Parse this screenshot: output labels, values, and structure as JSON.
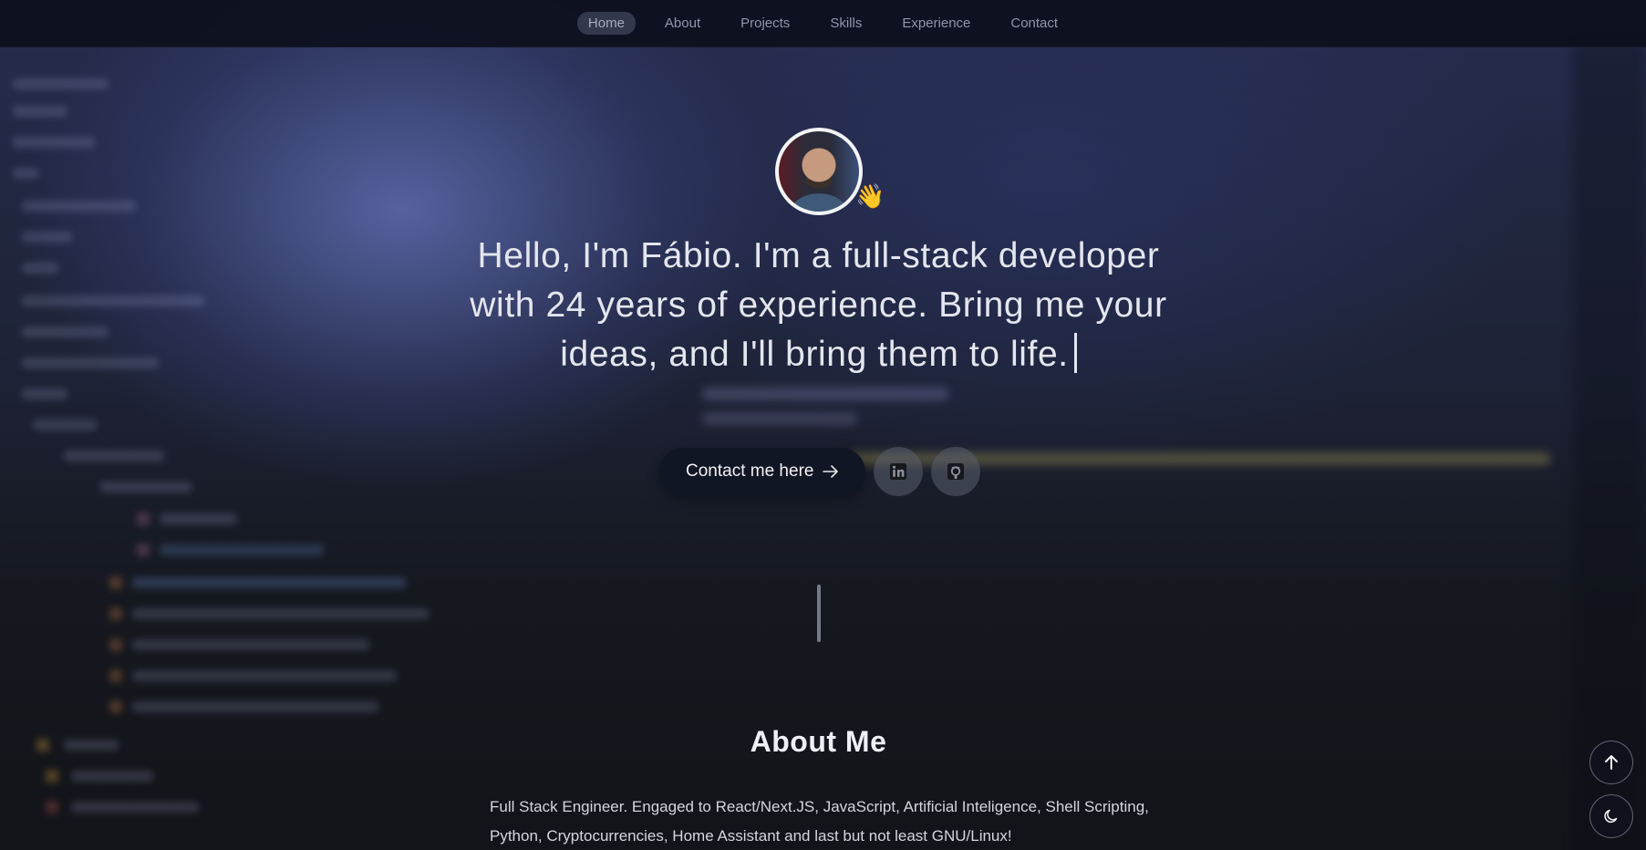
{
  "nav": {
    "items": [
      {
        "label": "Home",
        "active": true
      },
      {
        "label": "About",
        "active": false
      },
      {
        "label": "Projects",
        "active": false
      },
      {
        "label": "Skills",
        "active": false
      },
      {
        "label": "Experience",
        "active": false
      },
      {
        "label": "Contact",
        "active": false
      }
    ]
  },
  "hero": {
    "avatar_alt": "profile photo",
    "wave_emoji": "👋",
    "headline_line1": "Hello, I'm Fábio. I'm a full-stack developer",
    "headline_line2": "with 24 years of experience. Bring me your",
    "headline_line3": "ideas, and I'll bring them to life.",
    "contact_button": "Contact me here",
    "social": [
      {
        "icon": "linkedin-icon"
      },
      {
        "icon": "github-icon"
      }
    ]
  },
  "about": {
    "title": "About Me",
    "text_line1": "Full Stack Engineer. Engaged to React/Next.JS, JavaScript, Artificial Inteligence, Shell Scripting,",
    "text_line2": "Python, Cryptocurrencies, Home Assistant and last but not least GNU/Linux!"
  },
  "fab": {
    "scroll_top_icon": "arrow-up-icon",
    "theme_icon": "moon-icon"
  },
  "colors": {
    "nav_bg": "#0c0f1c",
    "button_bg": "#111625",
    "text": "#e4e6ee"
  }
}
